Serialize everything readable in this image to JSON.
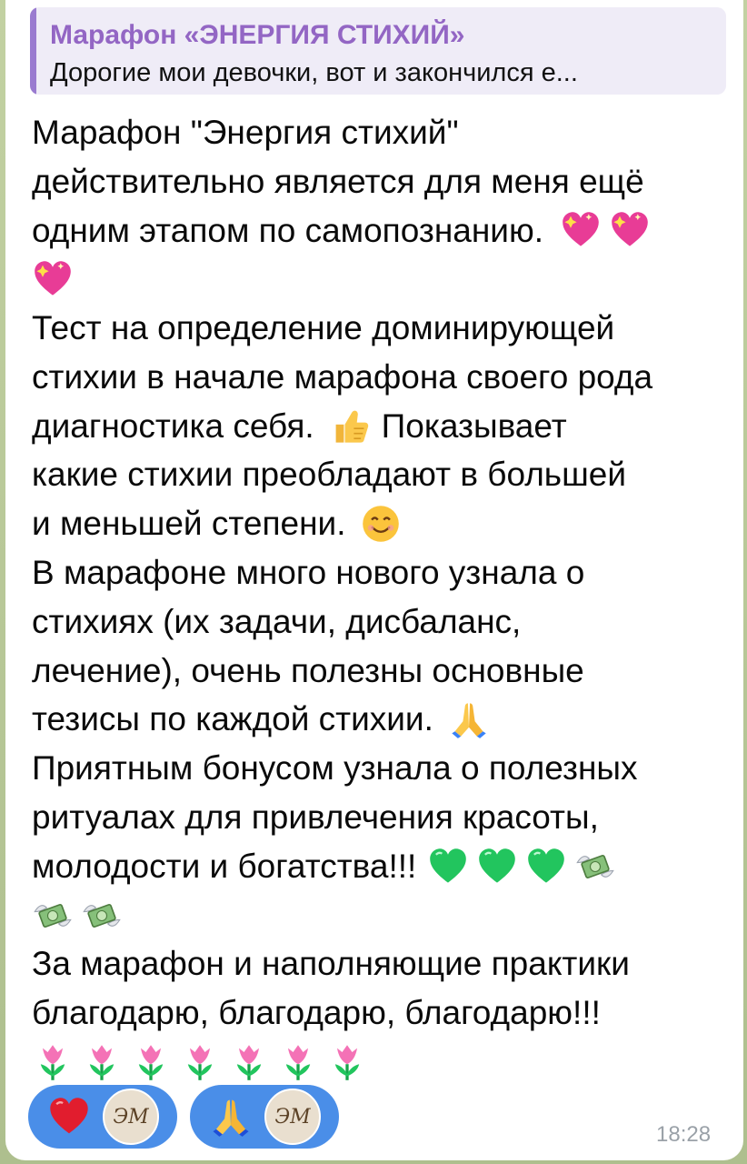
{
  "reply": {
    "title": "Марафон «ЭНЕРГИЯ СТИХИЙ»",
    "snippet": "Дорогие мои девочки, вот и закончился е..."
  },
  "message": {
    "lines": [
      "Марафон \"Энергия стихий\"",
      "действительно является для меня ещё",
      "одним этапом по самопознанию.",
      "",
      "Тест на определение доминирующей",
      "стихии в начале марафона своего рода",
      "диагностика себя.",
      "какие стихии преобладают в большей",
      "и меньшей степени.",
      "В марафоне много нового узнала о",
      "стихиях (их задачи, дисбаланс,",
      "лечение), очень полезны основные",
      "тезисы по каждой стихии.",
      "Приятным бонусом узнала о полезных",
      "ритуалах для привлечения красоты,",
      "молодости и богатства!!!",
      "",
      "За марафон и наполняющие практики",
      "благодарю, благодарю, благодарю!!!",
      ""
    ],
    "line7_tail": "Показывает"
  },
  "emoji": {
    "sparkling_heart": "sparkling-heart-icon",
    "thumbs_up": "thumbs-up-icon",
    "smile": "smiling-face-icon",
    "pray": "folded-hands-icon",
    "green_heart": "green-heart-icon",
    "money_wings": "money-with-wings-icon",
    "tulip": "tulip-icon"
  },
  "reactions": [
    {
      "emoji": "red-heart-icon",
      "avatar_text": "ЭМ"
    },
    {
      "emoji": "folded-hands-icon",
      "avatar_text": "ЭМ"
    }
  ],
  "timestamp": "18:28",
  "colors": {
    "reply_accent": "#9a7bd0",
    "reply_title": "#9366c4",
    "reaction_bg": "#4a8ee8",
    "timestamp": "#9aa1a8"
  }
}
